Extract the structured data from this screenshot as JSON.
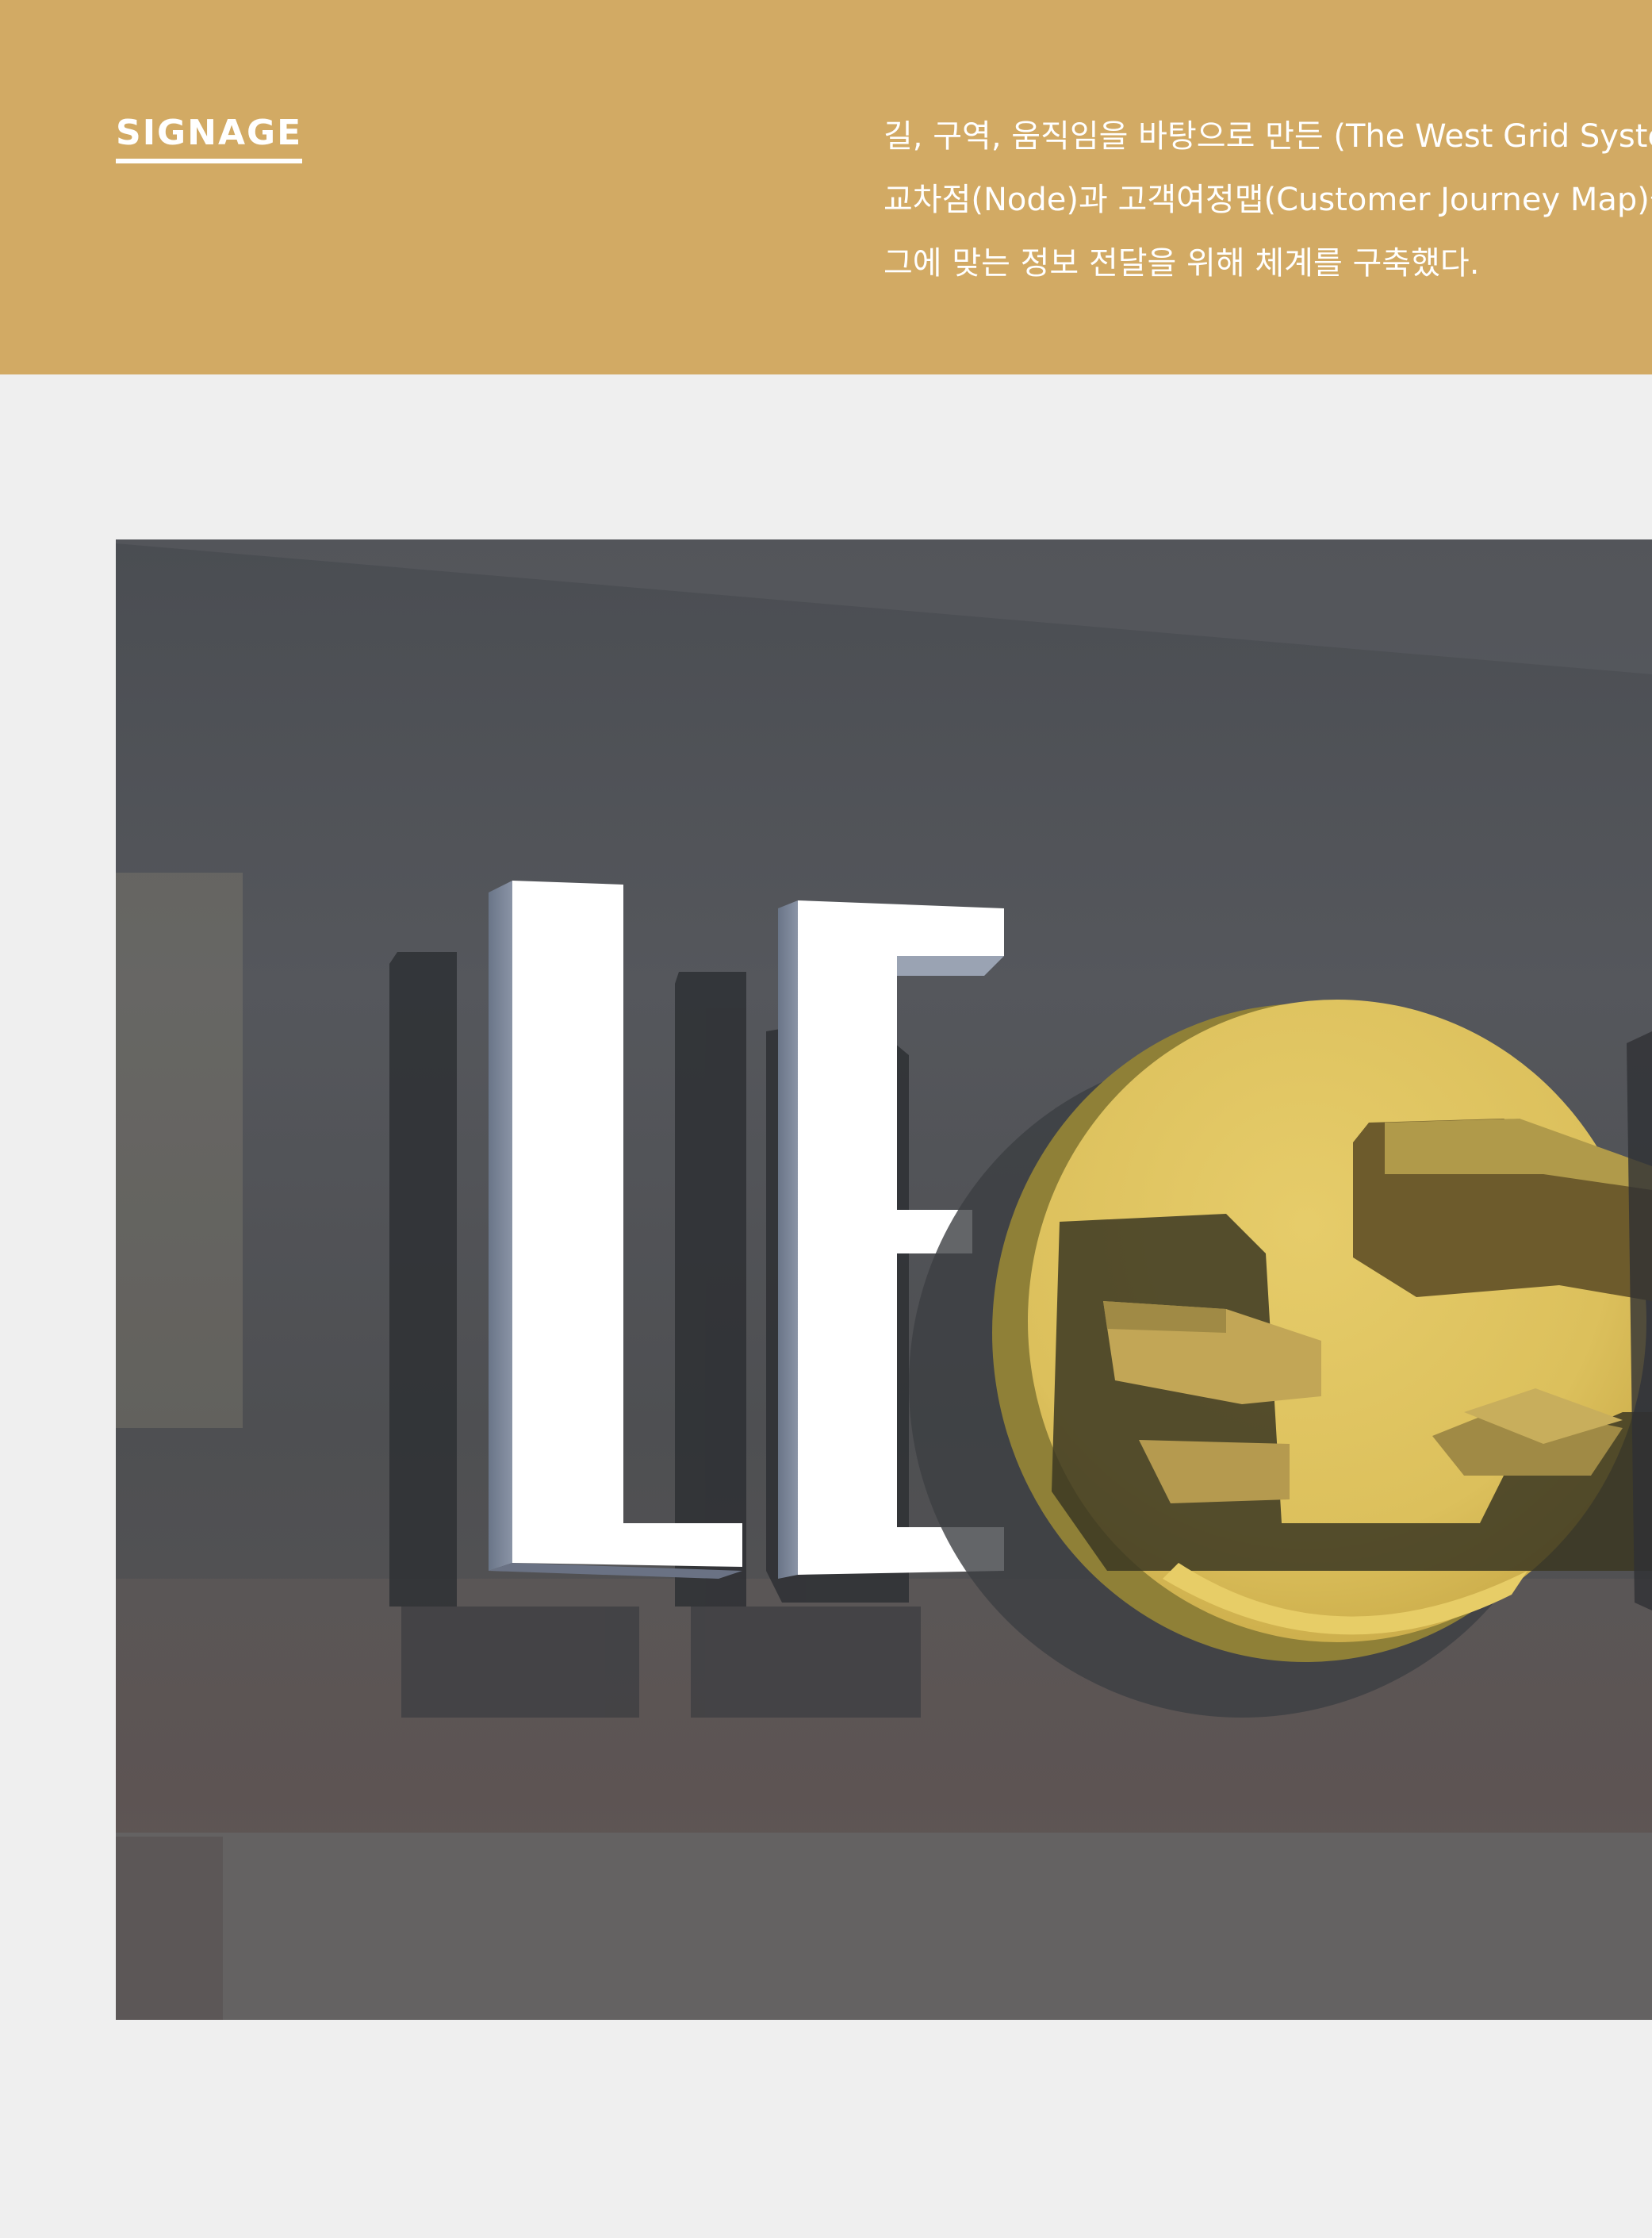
{
  "section": {
    "label": "SIGNAGE"
  },
  "description": {
    "lines": [
      "길, 구역, 움직임을 바탕으로 만든 (The West Grid Syste",
      "교차점(Node)과 고객여정맵(Customer Journey Map)을",
      "그에 맞는 정보 전달을 위해 체계를 구축했다."
    ]
  },
  "colors": {
    "header_band": "#d2aa64",
    "page_background": "#efefef",
    "label_text": "#ffffff",
    "sign_letters": "#ffffff",
    "sign_emblem": "#e2c462"
  },
  "image": {
    "letters": [
      "L",
      "E"
    ]
  }
}
